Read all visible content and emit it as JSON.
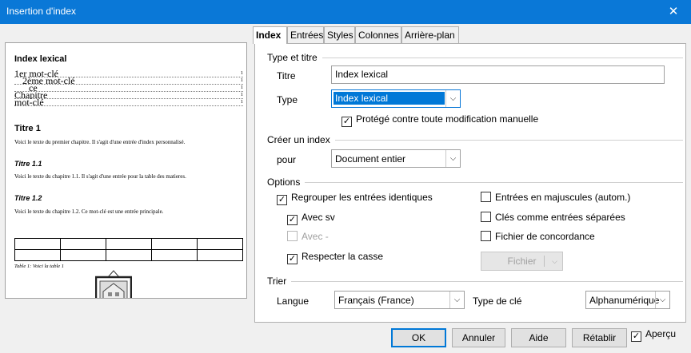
{
  "window": {
    "title": "Insertion d'index",
    "close_glyph": "✕"
  },
  "preview": {
    "heading": "Index lexical",
    "entries": [
      {
        "label": "1er mot-clé",
        "page": "1"
      },
      {
        "label": "2ème mot-clé",
        "page": "1"
      },
      {
        "label": "ce",
        "page": "1"
      },
      {
        "label": "Chapitre",
        "page": "1"
      },
      {
        "label": "mot-clé",
        "page": "1"
      }
    ],
    "title1": "Titre 1",
    "text1": "Voici le texte du premier chapitre. Il s'agit d'une entrée d'index personnalisé.",
    "title11": "Titre 1.1",
    "text11": "Voici le texte du chapitre 1.1. Il s'agit d'une entrée pour la table des matieres.",
    "title12": "Titre 1.2",
    "text12": "Voici le texte du chapitre 1.2. Ce mot-clé est une entrée principale.",
    "table_caption": "Table 1: Voici la table 1"
  },
  "tabs": [
    {
      "label": "Index",
      "active": true
    },
    {
      "label": "Entrées",
      "active": false
    },
    {
      "label": "Styles",
      "active": false
    },
    {
      "label": "Colonnes",
      "active": false
    },
    {
      "label": "Arrière-plan",
      "active": false
    }
  ],
  "sections": {
    "type_title": "Type et titre",
    "create_index": "Créer un index",
    "options": "Options",
    "sort": "Trier"
  },
  "fields": {
    "title_label": "Titre",
    "title_value": "Index lexical",
    "type_label": "Type",
    "type_value": "Index lexical",
    "protected_label": "Protégé contre toute modification manuelle",
    "for_label": "pour",
    "for_value": "Document entier",
    "language_label": "Langue",
    "language_value": "Français (France)",
    "keytype_label": "Type de clé",
    "keytype_value": "Alphanumérique"
  },
  "options": {
    "combine": "Regrouper les entrées identiques",
    "with_ff": "Avec sv",
    "with_dash": "Avec -",
    "case_sensitive": "Respecter la casse",
    "uppercase": "Entrées en majuscules (autom.)",
    "separate_keys": "Clés comme entrées séparées",
    "concordance": "Fichier de concordance",
    "file_button": "Fichier"
  },
  "buttons": {
    "ok": "OK",
    "cancel": "Annuler",
    "help": "Aide",
    "reset": "Rétablir",
    "preview": "Aperçu"
  },
  "glyphs": {
    "check": "✓",
    "down": "⌵"
  }
}
